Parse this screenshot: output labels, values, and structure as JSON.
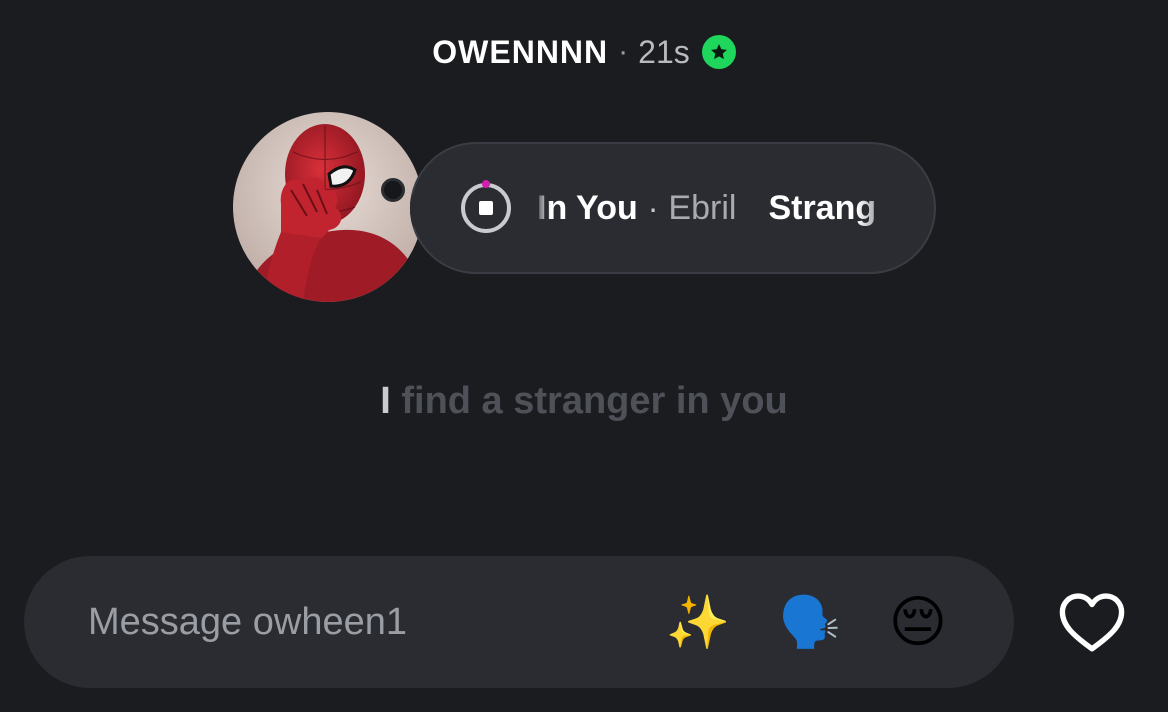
{
  "header": {
    "username": "OWENNNN",
    "separator": "·",
    "elapsed": "21s",
    "badge_icon": "star-badge-icon",
    "badge_color": "#1ed65b"
  },
  "note": {
    "song_title": "In You",
    "separator": "·",
    "artist": "Ebril",
    "next_text": "Strang",
    "progress_color": "#d21fae"
  },
  "lyric": {
    "cursor": "I",
    "text": "find a stranger in you"
  },
  "composer": {
    "placeholder": "Message owheen1",
    "emoji_1": "✨",
    "emoji_2": "🗣️",
    "emoji_3": "😔"
  },
  "icons": {
    "like": "heart-outline-icon",
    "stop": "stop-icon"
  }
}
